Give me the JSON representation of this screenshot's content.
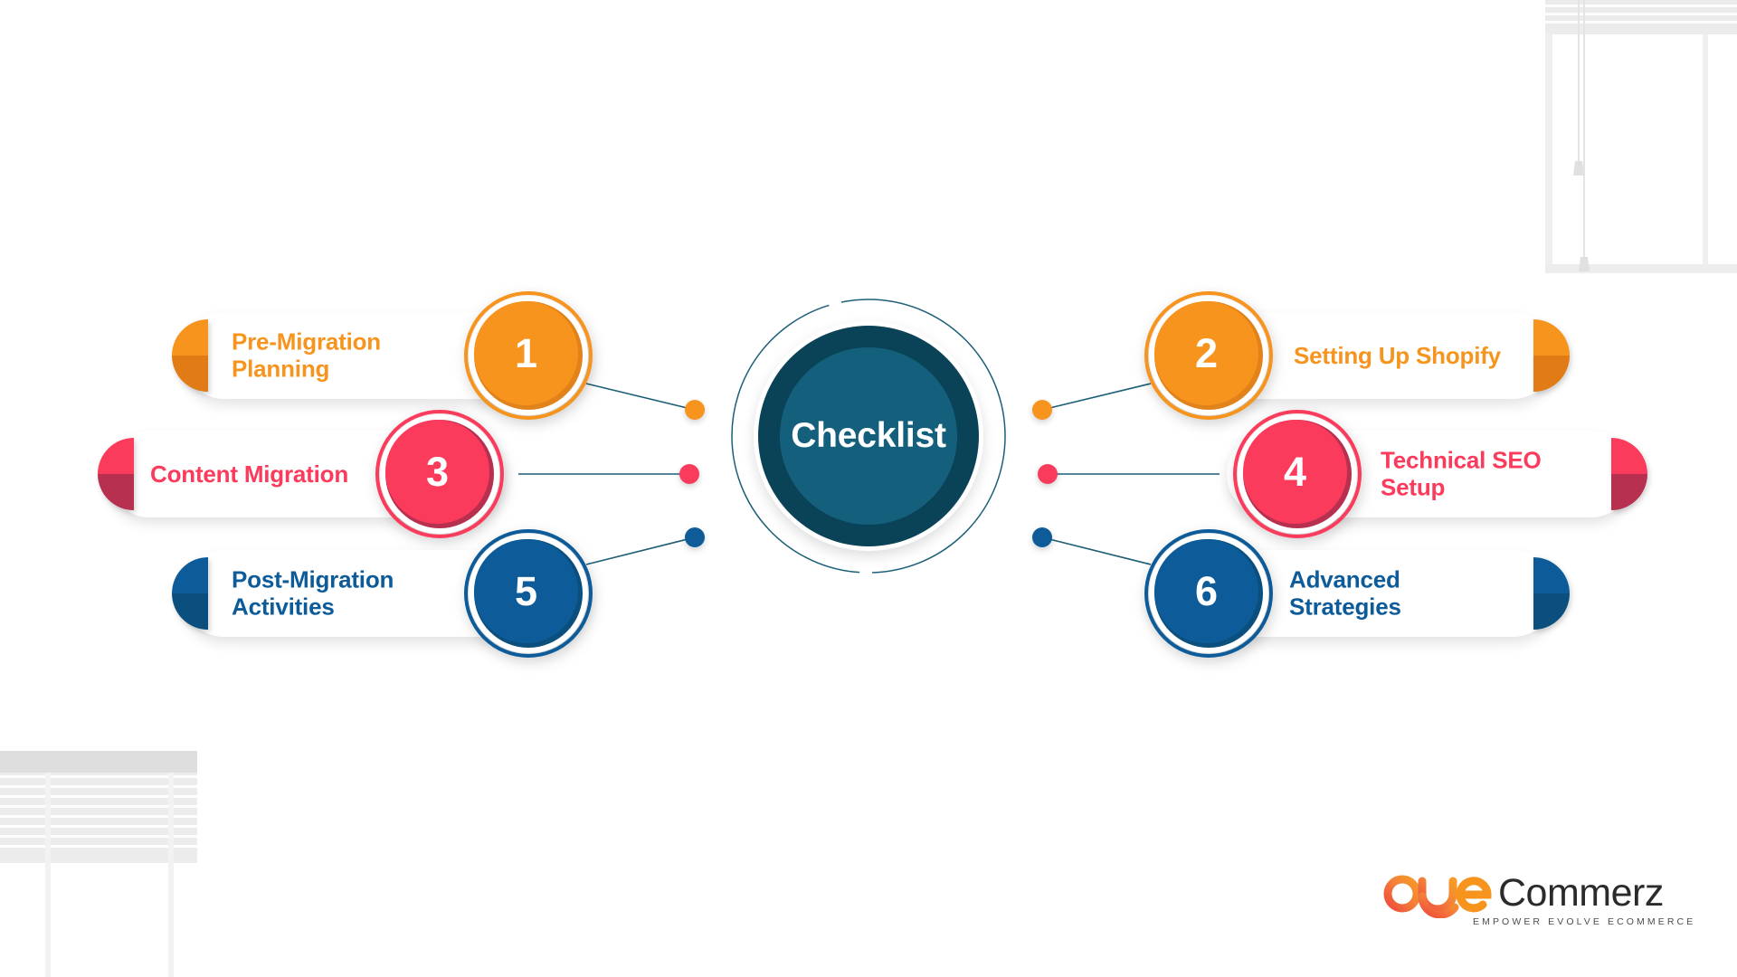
{
  "center": {
    "label": "Checklist"
  },
  "colors": {
    "orange": "#F7941E",
    "orange_dark": "#E07B15",
    "orange_shade": "#E2821A",
    "pink": "#FB3B5C",
    "pink_dark": "#B7304F",
    "pink_shade": "#B7304F",
    "blue": "#0D5C99",
    "blue_dark": "#0B4F7E",
    "blue_shade": "#0B4F7E",
    "teal_dark": "#0A4257",
    "teal_core": "#14607C",
    "connector": "#1C5F77"
  },
  "items": [
    {
      "number": "1",
      "label": "Pre-Migration Planning",
      "label_lines": [
        "Pre-Migration",
        "Planning"
      ],
      "side": "left",
      "color": "orange"
    },
    {
      "number": "2",
      "label": "Setting Up Shopify",
      "label_lines": [
        "Setting Up Shopify"
      ],
      "side": "right",
      "color": "orange"
    },
    {
      "number": "3",
      "label": "Content Migration",
      "label_lines": [
        "Content Migration"
      ],
      "side": "left",
      "color": "pink"
    },
    {
      "number": "4",
      "label": "Technical SEO Setup",
      "label_lines": [
        "Technical SEO",
        "Setup"
      ],
      "side": "right",
      "color": "pink"
    },
    {
      "number": "5",
      "label": "Post-Migration Activities",
      "label_lines": [
        "Post-Migration",
        "Activities"
      ],
      "side": "left",
      "color": "blue"
    },
    {
      "number": "6",
      "label": "Advanced Strategies",
      "label_lines": [
        "Advanced",
        "Strategies"
      ],
      "side": "right",
      "color": "blue"
    }
  ],
  "logo": {
    "brand_accent": "oye",
    "brand_main": "Commerz",
    "tagline": "EMPOWER EVOLVE ECOMMERCE"
  }
}
